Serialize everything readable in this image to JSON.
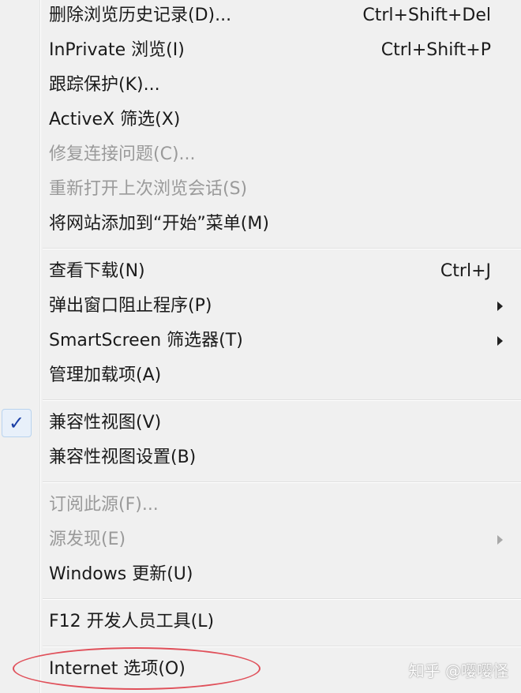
{
  "menu": {
    "items": [
      {
        "label": "删除浏览历史记录(D)...",
        "shortcut": "Ctrl+Shift+Del"
      },
      {
        "label": "InPrivate 浏览(I)",
        "shortcut": "Ctrl+Shift+P"
      },
      {
        "label": "跟踪保护(K)..."
      },
      {
        "label": "ActiveX 筛选(X)"
      },
      {
        "label": "修复连接问题(C)...",
        "disabled": true
      },
      {
        "label": "重新打开上次浏览会话(S)",
        "disabled": true
      },
      {
        "label": "将网站添加到“开始”菜单(M)"
      },
      {
        "label": "查看下载(N)",
        "shortcut": "Ctrl+J"
      },
      {
        "label": "弹出窗口阻止程序(P)",
        "submenu": true
      },
      {
        "label": "SmartScreen 筛选器(T)",
        "submenu": true
      },
      {
        "label": "管理加载项(A)"
      },
      {
        "label": "兼容性视图(V)",
        "checked": true,
        "check_glyph": "✓"
      },
      {
        "label": "兼容性视图设置(B)"
      },
      {
        "label": "订阅此源(F)...",
        "disabled": true
      },
      {
        "label": "源发现(E)",
        "disabled": true,
        "submenu": true
      },
      {
        "label": "Windows 更新(U)"
      },
      {
        "label": "F12 开发人员工具(L)"
      },
      {
        "label": "Internet 选项(O)",
        "highlighted": true
      }
    ]
  },
  "watermark": "知乎 @嘤嘤怪",
  "colors": {
    "menu_bg": "#f0f0f0",
    "text": "#1a1a1a",
    "disabled_text": "#9a9a9a",
    "check": "#1a3fa6",
    "highlight_ellipse": "#e0505a"
  }
}
